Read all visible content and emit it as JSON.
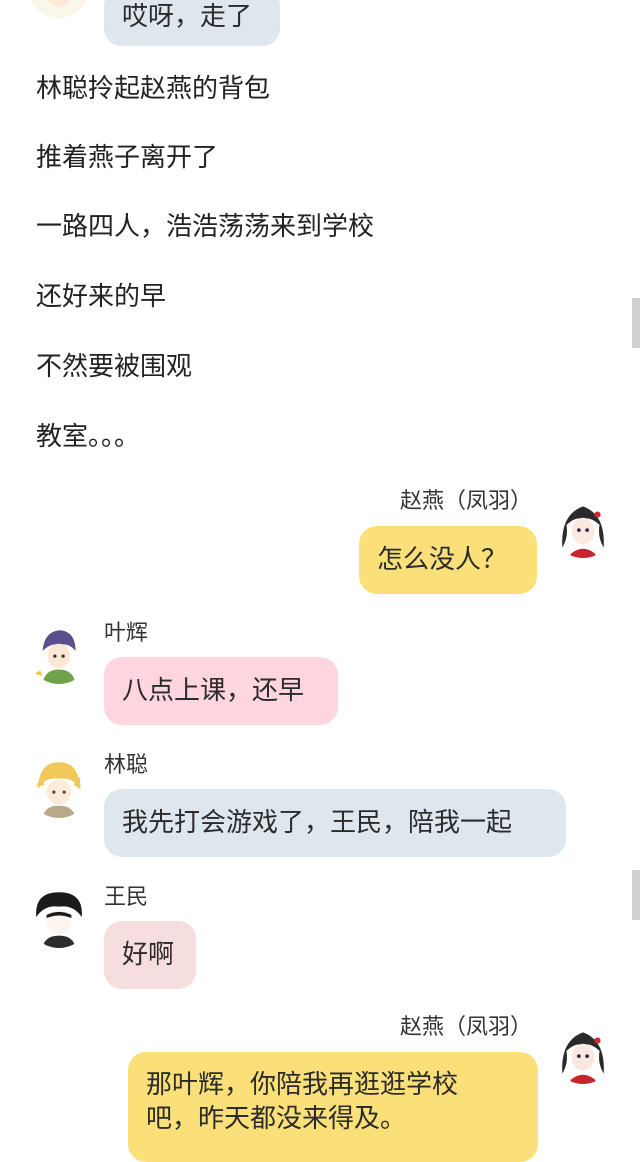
{
  "top_message": {
    "text": "哎呀，走了",
    "bubble_color": "#dfe7ee"
  },
  "narration": [
    "林聪拎起赵燕的背包",
    "推着燕子离开了",
    "一路四人，浩浩荡荡来到学校",
    "还好来的早",
    "不然要被围观",
    "教室。。。"
  ],
  "messages": [
    {
      "speaker": "赵燕（凤羽）",
      "text": "怎么没人？",
      "side": "right",
      "avatar": "girl-avatar-icon",
      "bubble_color": "#fbe07a"
    },
    {
      "speaker": "叶辉",
      "text": "八点上课，还早",
      "side": "left",
      "avatar": "boy-green-avatar-icon",
      "bubble_color": "#ffd5e0"
    },
    {
      "speaker": "林聪",
      "text": "我先打会游戏了，王民，陪我一起",
      "side": "left",
      "avatar": "boy-blond-avatar-icon",
      "bubble_color": "#dfe7ee"
    },
    {
      "speaker": "王民",
      "text": "好啊",
      "side": "left",
      "avatar": "boy-dark-avatar-icon",
      "bubble_color": "#f6dede"
    },
    {
      "speaker": "赵燕（凤羽）",
      "text_lines": [
        "那叶辉，你陪我再逛逛学校",
        "吧，昨天都没来得及。"
      ],
      "side": "right",
      "avatar": "girl-avatar-icon",
      "bubble_color": "#fbe07a"
    }
  ]
}
